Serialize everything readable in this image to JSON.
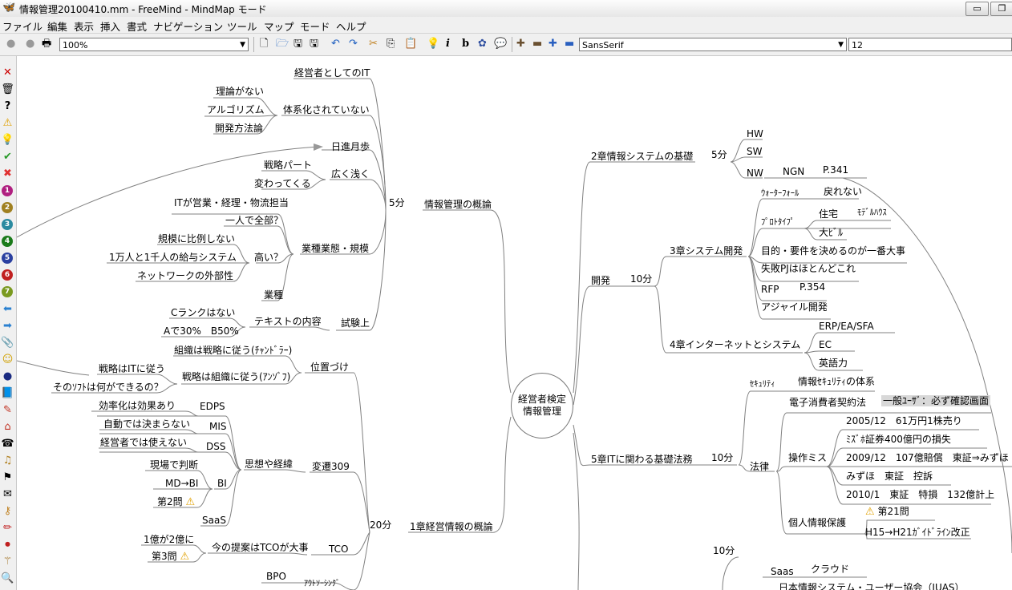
{
  "window": {
    "title": "情報管理20100410.mm - FreeMind - MindMap モード",
    "minimize": "▭",
    "maximize": "❐"
  },
  "menu": [
    "ファイル",
    "編集",
    "表示",
    "挿入",
    "書式",
    "ナビゲーション",
    "ツール",
    "マップ",
    "モード",
    "ヘルプ"
  ],
  "toolbar": {
    "zoom": "100%",
    "font": "SansSerif",
    "font_size": "12"
  },
  "colors": {
    "edge": "#808080",
    "selected": "#d8d8d8"
  },
  "mindmap": {
    "root": {
      "line1": "経営者検定",
      "line2": "情報管理"
    },
    "left": {
      "ch2": "情報管理の概論",
      "time_5": "5分",
      "it": "経営者としてのIT",
      "systematic": "体系化されていない",
      "theory": "理論がない",
      "algorithm": "アルゴリズム",
      "devmethod": "開発方法論",
      "daily": "日進月歩",
      "wide": "広く浅く",
      "strategy_part": "戦略パート",
      "changing": "変わってくる",
      "industry": "業種業態・規模",
      "it_sales": "ITが営業・経理・物流担当",
      "one_all": "一人で全部？",
      "high": "高い？",
      "not_prop": "規模に比例しない",
      "salary": "1万人と1千人の給与システム",
      "network": "ネットワークの外部性",
      "gyoushu": "業種",
      "exam": "試験上",
      "text_content": "テキストの内容",
      "no_c": "Cランクはない",
      "a30": "Aで30%　B50%",
      "position": "位置づけ",
      "org_follows": "組織は戦略に従う(ﾁｬﾝﾄﾞﾗｰ)",
      "strat_follows": "戦略は組織に従う(ｱﾝｿﾞﾌ)",
      "strat_it": "戦略はITに従う",
      "soft_what": "そのｿﾌﾄは何ができるの？",
      "ch1": "1章経営情報の概論",
      "time_20": "20分",
      "transition": "変遷309",
      "thought": "思想や経緯",
      "edps": "EDPS",
      "efficient": "効率化は効果あり",
      "mis": "MIS",
      "auto": "自動では決まらない",
      "dss": "DSS",
      "mgmt": "経営者では使えない",
      "bi": "BI",
      "field": "現場で判断",
      "md": "MD→BI",
      "q2": "第2問",
      "saas": "SaaS",
      "tco": "TCO",
      "proposal": "今の提案はTCOが大事",
      "oku": "1億が2億に",
      "q3": "第3問",
      "outsourcing": "ｱｳﾄｿｰｼﾝｸﾞ",
      "bpo": "BPO"
    },
    "right": {
      "ch2basis": "2章情報システムの基礎",
      "time_5": "5分",
      "hw": "HW",
      "sw": "SW",
      "nw": "NW",
      "ngn": "NGN",
      "p341": "P.341",
      "dev": "開発",
      "time_10": "10分",
      "ch3": "3章システム開発",
      "waterfall": "ｳｫｰﾀｰﾌｫｰﾙ",
      "no_return": "戻れない",
      "prototype": "ﾌﾟﾛﾄﾀｲﾌﾟ",
      "house": "住宅",
      "model": "ﾓﾃﾞﾙﾊｳｽ",
      "building": "大ﾋﾞﾙ",
      "purpose": "目的・要件を決めるのが一番大事",
      "failure": "失敗PJはほとんどこれ",
      "rfp": "RFP",
      "p354": "P.354",
      "agile": "アジャイル開発",
      "ch4": "4章インターネットとシステム",
      "erp": "ERP/EA/SFA",
      "ec": "EC",
      "eigo": "英語力",
      "ch5": "5章ITに関わる基礎法務",
      "time_10b": "10分",
      "security": "ｾｷｭﾘﾃｨ",
      "sec_system": "情報ｾｷｭﾘﾃｨの体系",
      "law": "法律",
      "consumer": "電子消費者契約法",
      "general_user": "一般ﾕｰｻﾞ：必ず確認画面",
      "op_miss": "操作ミス",
      "d2005": "2005/12　61万円1株売り",
      "mizuho_sec": "ﾐｽﾞﾎ証券400億円の損失",
      "d2009": "2009/12　107億賠償　東証⇒みずほ",
      "mizuho_appeal": "みずほ　東証　控訴",
      "d2010": "2010/1　東証　特損　132億計上",
      "privacy": "個人情報保護",
      "q21": "第21問",
      "h15": "H15→H21ｶﾞｲﾄﾞﾗｲﾝ改正",
      "time_10c": "10分",
      "saas_r": "Saas",
      "cloud": "クラウド",
      "juas": "日本情報システム・ユーザー協会（JUAS）"
    }
  }
}
